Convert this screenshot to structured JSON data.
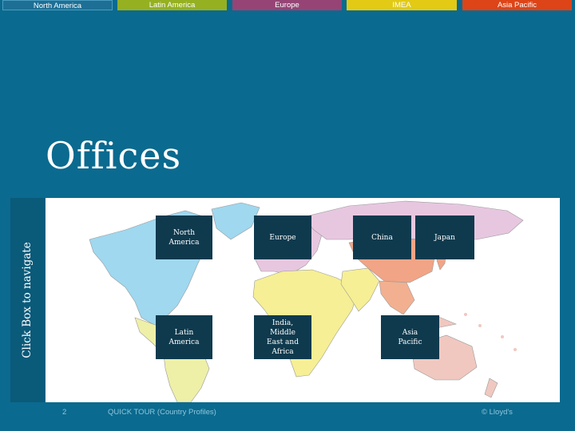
{
  "nav_tabs": {
    "north_america": "North America",
    "latin_america": "Latin America",
    "europe": "Europe",
    "imea": "IMEA",
    "asia_pacific": "Asia Pacific"
  },
  "title": "Offices",
  "side_label": "Click Box to navigate",
  "regions": {
    "north_america": "North\nAmerica",
    "europe": "Europe",
    "china": "China",
    "japan": "Japan",
    "latin_america": "Latin\nAmerica",
    "imea": "India,\nMiddle\nEast and\nAfrica",
    "asia_pacific": "Asia\nPacific"
  },
  "footer": {
    "page_number": "2",
    "quick_tour": "QUICK TOUR (Country Profiles)",
    "copyright": "© Lloyd's"
  },
  "colors": {
    "background": "#0b6a8f",
    "north_america": "#9fd8ef",
    "latin_america": "#eef0a8",
    "europe": "#e7c7e0",
    "africa": "#f6ef95",
    "asia": "#f2a486",
    "pacific": "#f0c8c0"
  }
}
